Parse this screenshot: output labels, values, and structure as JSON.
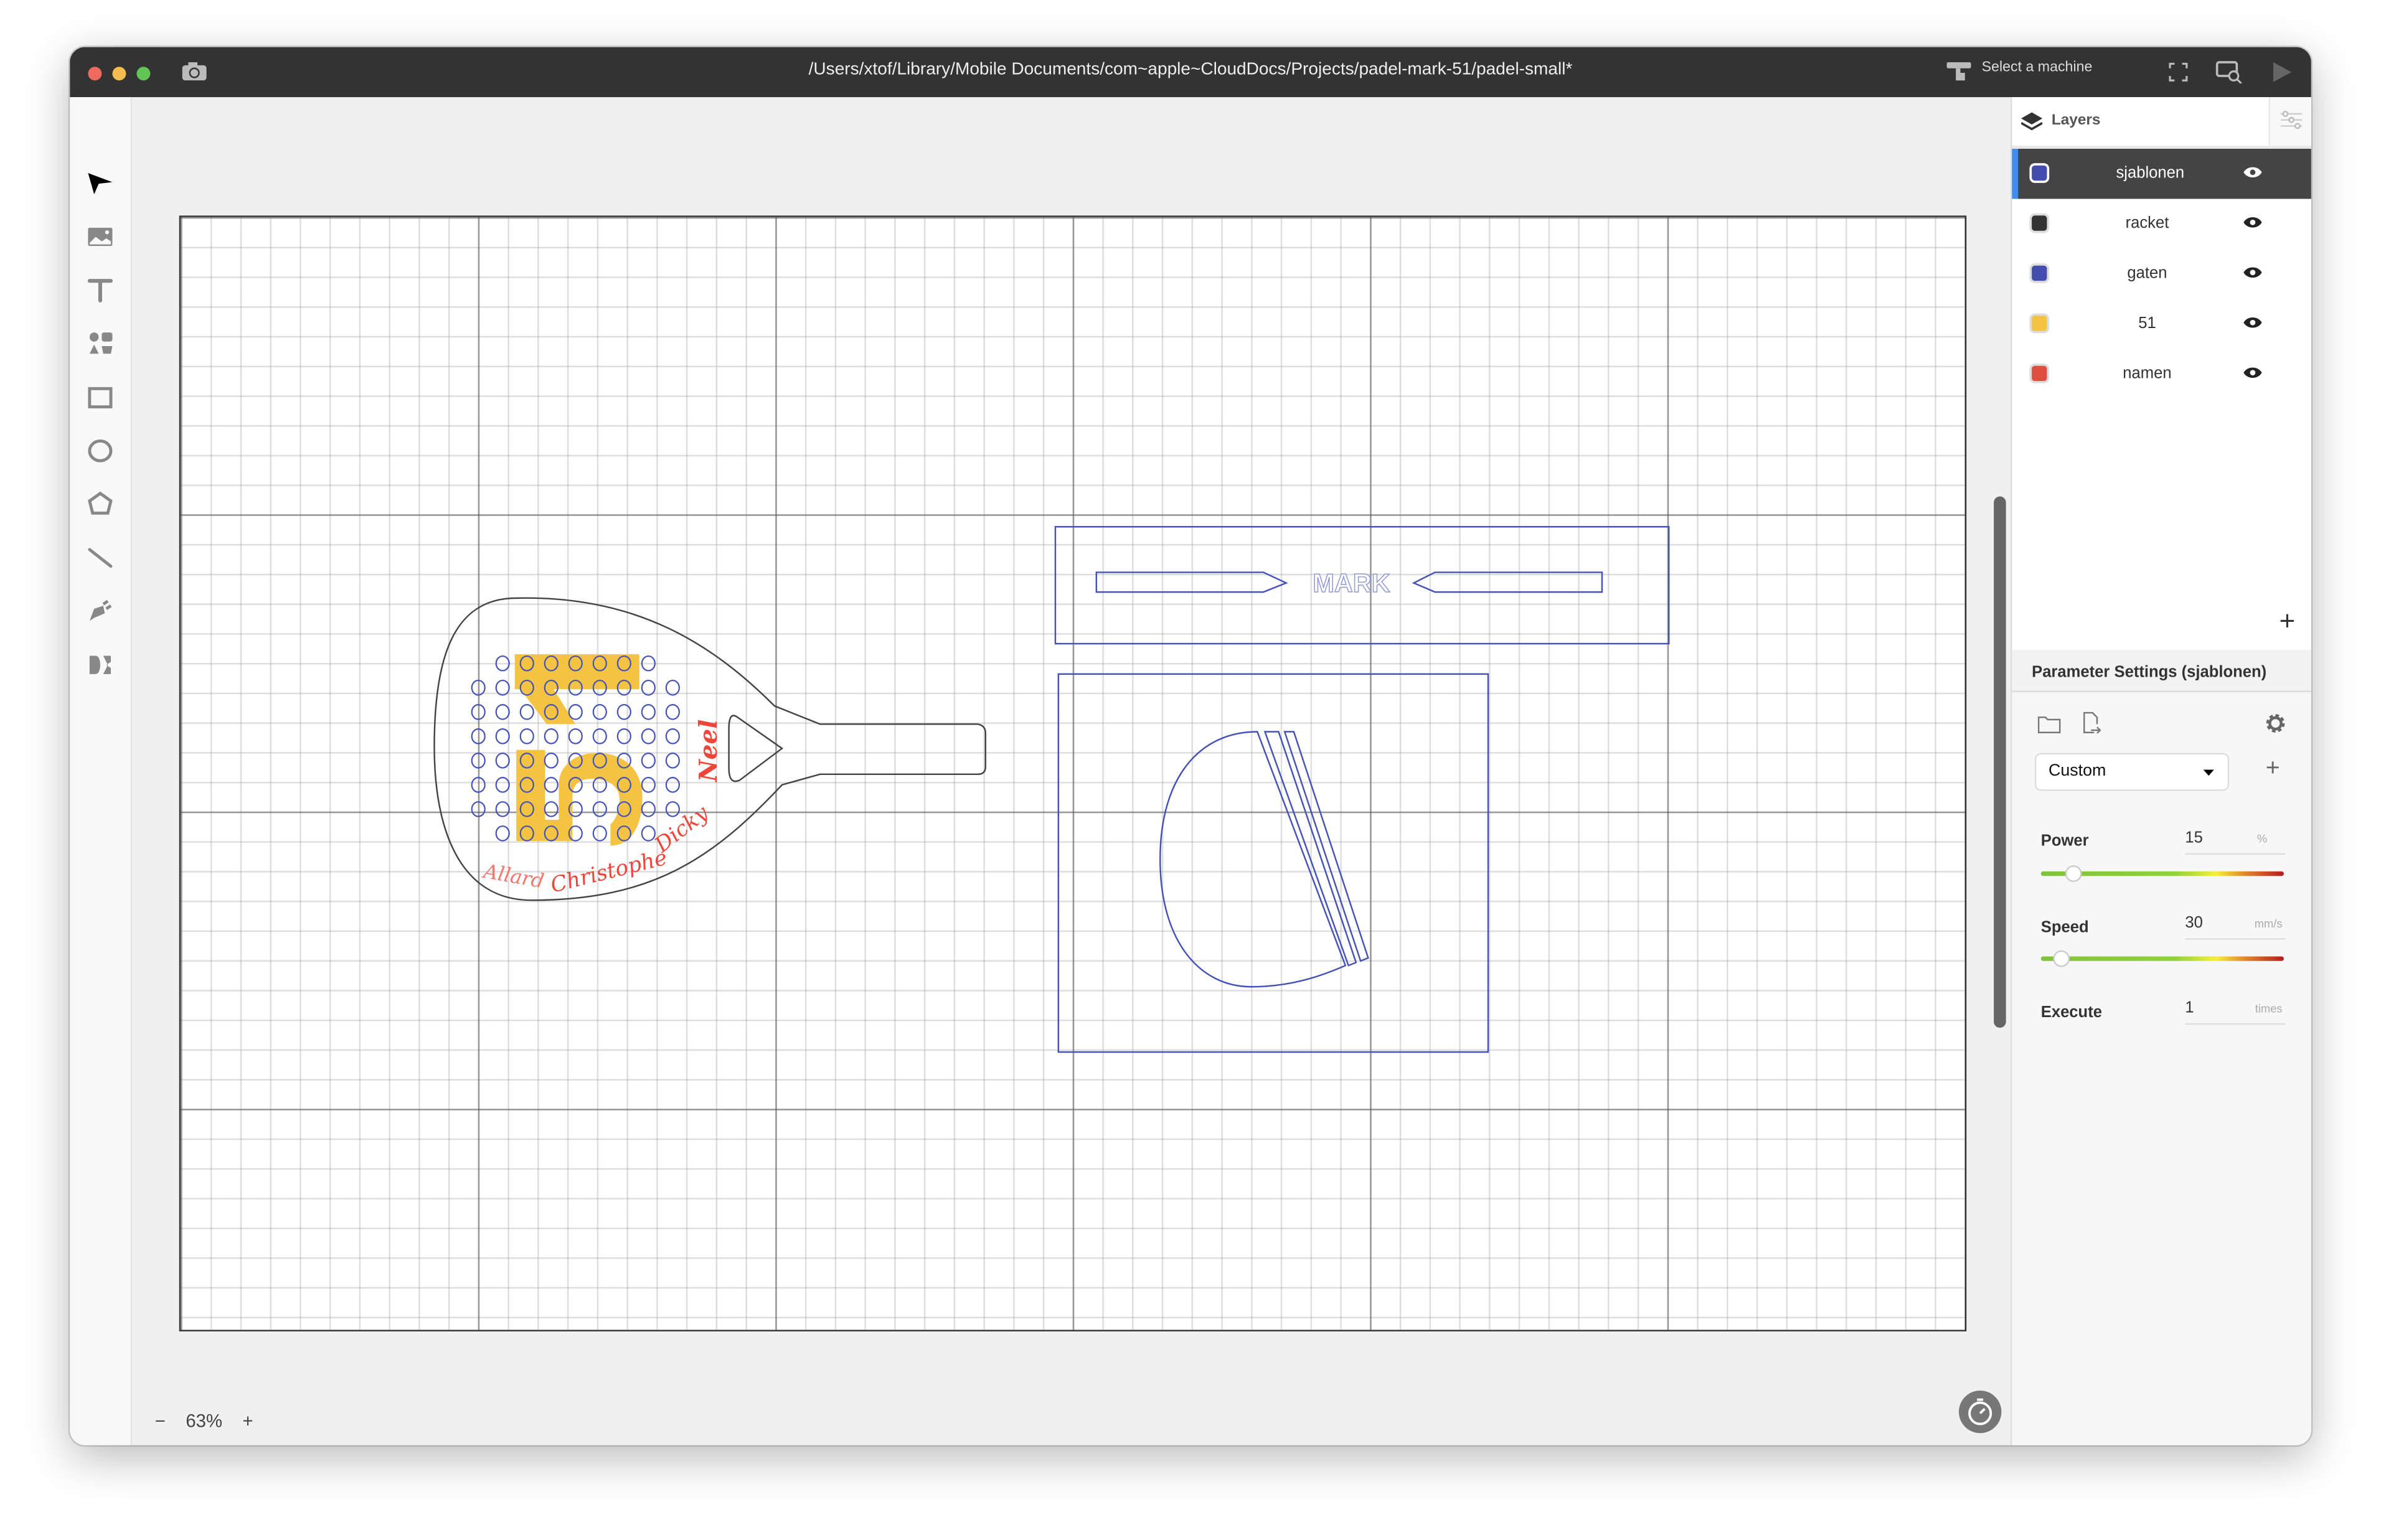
{
  "window": {
    "title": "/Users/xtof/Library/Mobile Documents/com~apple~CloudDocs/Projects/padel-mark-51/padel-small*"
  },
  "titlebar": {
    "machine_label": "Select a machine"
  },
  "toolbar": {
    "tools": [
      "select-arrow-icon",
      "image-icon",
      "text-icon",
      "shapes-icon",
      "rectangle-icon",
      "ellipse-icon",
      "polygon-icon",
      "line-icon",
      "pen-icon",
      "mirror-icon"
    ]
  },
  "canvas": {
    "mark_text": "MARK",
    "signatures": [
      "Allard",
      "Christophe",
      "Dicky",
      "Neel"
    ],
    "logo_number": "51"
  },
  "zoom": {
    "minus": "−",
    "level": "63%",
    "plus": "+"
  },
  "layers": {
    "title": "Layers",
    "items": [
      {
        "name": "sjablonen",
        "color": "#444cae",
        "selected": true
      },
      {
        "name": "racket",
        "color": "#333333"
      },
      {
        "name": "gaten",
        "color": "#444cae"
      },
      {
        "name": "51",
        "color": "#f5c342"
      },
      {
        "name": "namen",
        "color": "#e04e3f"
      }
    ],
    "add": "+"
  },
  "params": {
    "title": "Parameter Settings (sjablonen)",
    "preset": "Custom",
    "add": "+",
    "power": {
      "label": "Power",
      "value": "15",
      "unit": "%",
      "slider_fraction": 0.14
    },
    "speed": {
      "label": "Speed",
      "value": "30",
      "unit": "mm/s",
      "slider_fraction": 0.09
    },
    "execute": {
      "label": "Execute",
      "value": "1",
      "unit": "times"
    }
  },
  "colors": {
    "template": "#4452b8",
    "racket": "#444444",
    "yellow": "#f5c342",
    "red": "#f0453a",
    "accent": "#3d8ef0"
  }
}
